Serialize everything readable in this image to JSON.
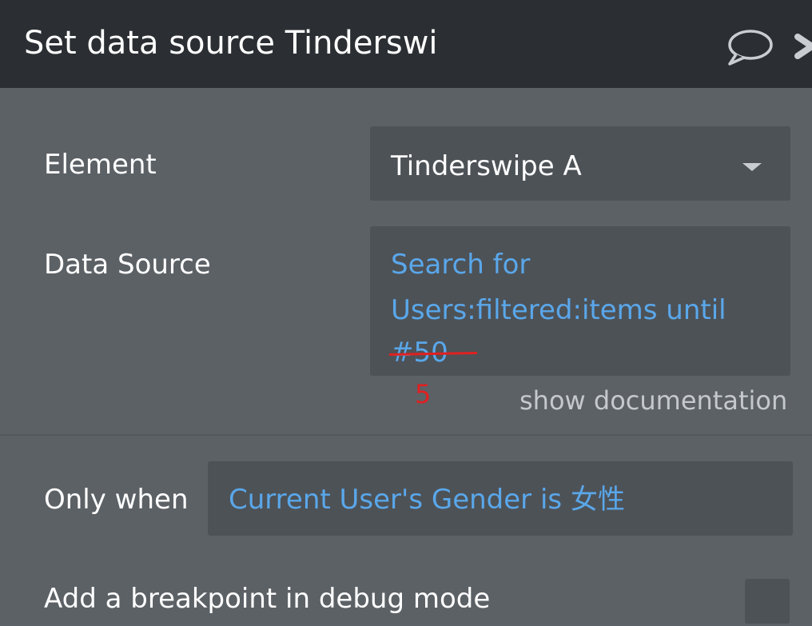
{
  "header": {
    "title": "Set data source Tinderswi",
    "comment_icon": "speech-bubble-icon",
    "close_icon": "close-icon"
  },
  "element_field": {
    "label": "Element",
    "value": "Tinderswipe A"
  },
  "data_source_field": {
    "label": "Data Source",
    "line1": "Search for",
    "line2": "Users:filtered:items until",
    "line3": "#50",
    "annotation": "5",
    "show_documentation": "show documentation"
  },
  "only_when_field": {
    "label": "Only when",
    "value": "Current User's Gender is 女性"
  },
  "debug_field": {
    "label": "Add a breakpoint in debug mode",
    "checked": false
  },
  "colors": {
    "panel_bg": "#5c6166",
    "header_bg": "#2b2f33",
    "input_bg": "#4d5257",
    "expression_text": "#5aa7ea",
    "annotation_red": "#e02020"
  }
}
